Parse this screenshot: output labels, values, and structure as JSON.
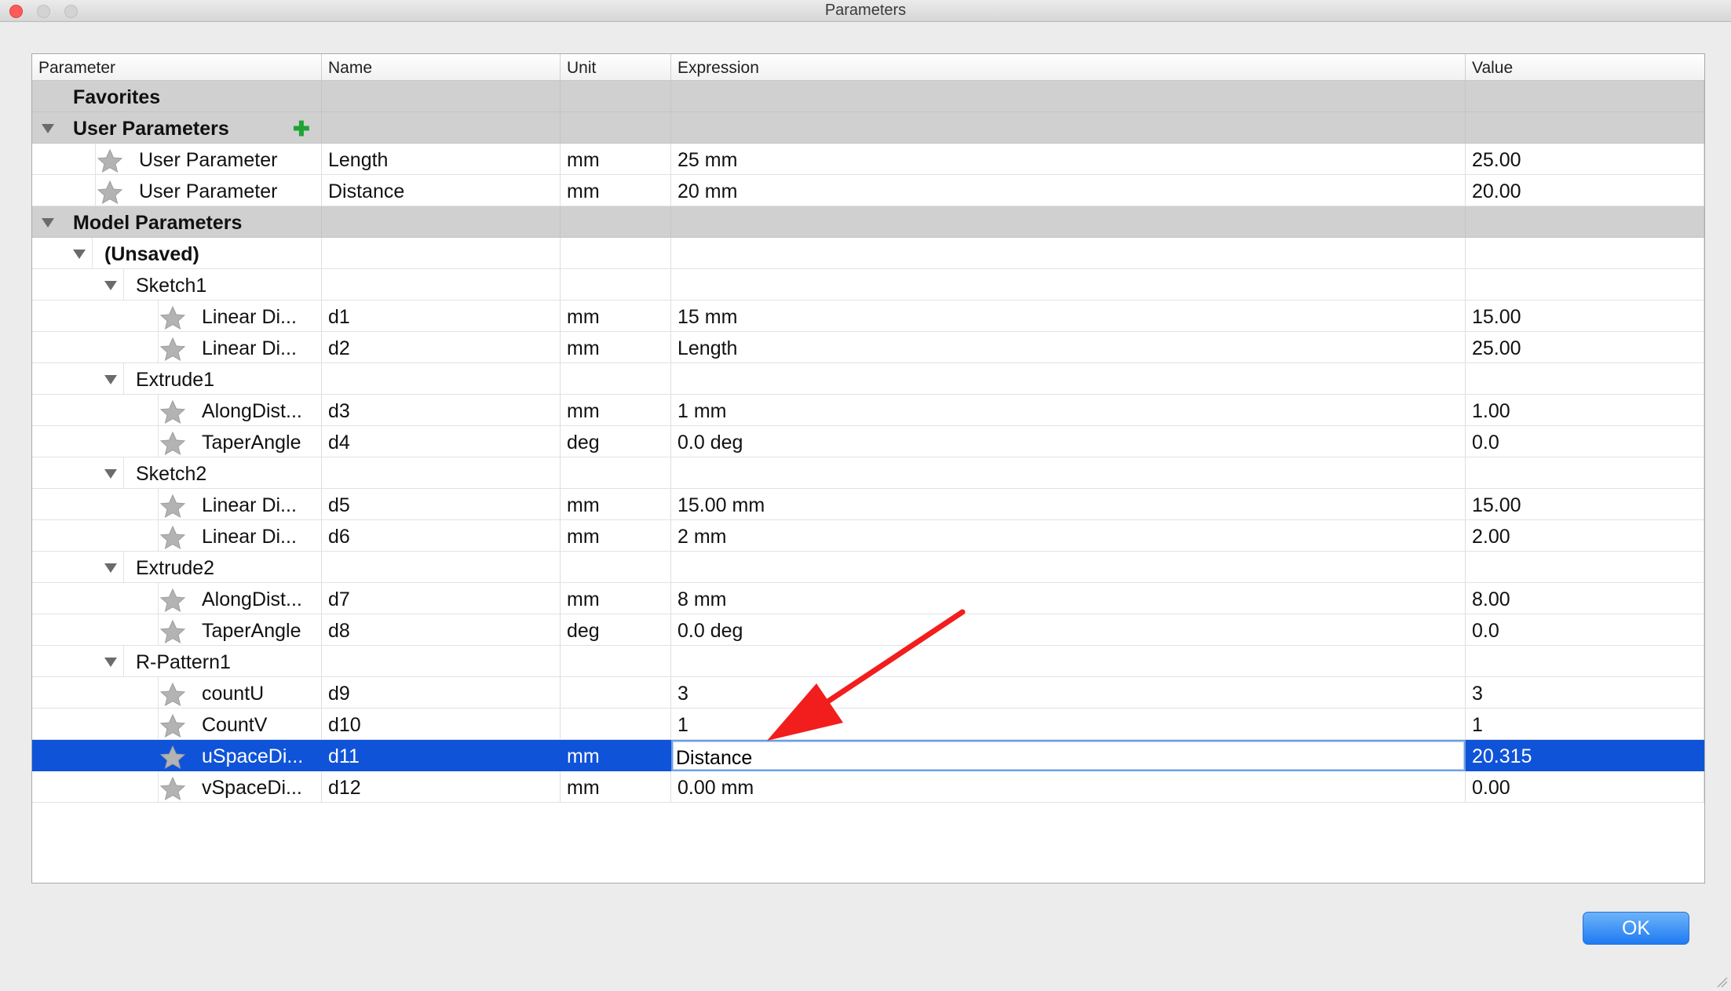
{
  "window": {
    "title": "Parameters"
  },
  "table": {
    "columns": [
      "Parameter",
      "Name",
      "Unit",
      "Expression",
      "Value"
    ],
    "rows": [
      {
        "kind": "group",
        "level": 0,
        "expander": false,
        "parameter": "Favorites",
        "name": "",
        "unit": "",
        "expression": "",
        "value": ""
      },
      {
        "kind": "group",
        "level": 0,
        "expander": true,
        "parameter": "User Parameters",
        "add": true,
        "name": "",
        "unit": "",
        "expression": "",
        "value": ""
      },
      {
        "kind": "param",
        "level": 1,
        "star": true,
        "parameter": "User Parameter",
        "name": "Length",
        "unit": "mm",
        "expression": "25 mm",
        "value": "25.00"
      },
      {
        "kind": "param",
        "level": 1,
        "star": true,
        "parameter": "User Parameter",
        "name": "Distance",
        "unit": "mm",
        "expression": "20 mm",
        "value": "20.00"
      },
      {
        "kind": "group",
        "level": 0,
        "expander": true,
        "parameter": "Model Parameters",
        "name": "",
        "unit": "",
        "expression": "",
        "value": ""
      },
      {
        "kind": "folder",
        "level": 1,
        "expander": true,
        "bold": true,
        "parameter": "(Unsaved)",
        "name": "",
        "unit": "",
        "expression": "",
        "value": ""
      },
      {
        "kind": "folder",
        "level": 2,
        "expander": true,
        "parameter": "Sketch1",
        "name": "",
        "unit": "",
        "expression": "",
        "value": ""
      },
      {
        "kind": "param",
        "level": 3,
        "star": true,
        "parameter": "Linear Di...",
        "name": "d1",
        "unit": "mm",
        "expression": "15 mm",
        "value": "15.00"
      },
      {
        "kind": "param",
        "level": 3,
        "star": true,
        "parameter": "Linear Di...",
        "name": "d2",
        "unit": "mm",
        "expression": "Length",
        "value": "25.00"
      },
      {
        "kind": "folder",
        "level": 2,
        "expander": true,
        "parameter": "Extrude1",
        "name": "",
        "unit": "",
        "expression": "",
        "value": ""
      },
      {
        "kind": "param",
        "level": 3,
        "star": true,
        "parameter": "AlongDist...",
        "name": "d3",
        "unit": "mm",
        "expression": "1 mm",
        "value": "1.00"
      },
      {
        "kind": "param",
        "level": 3,
        "star": true,
        "parameter": "TaperAngle",
        "name": "d4",
        "unit": "deg",
        "expression": "0.0 deg",
        "value": "0.0"
      },
      {
        "kind": "folder",
        "level": 2,
        "expander": true,
        "parameter": "Sketch2",
        "name": "",
        "unit": "",
        "expression": "",
        "value": ""
      },
      {
        "kind": "param",
        "level": 3,
        "star": true,
        "parameter": "Linear Di...",
        "name": "d5",
        "unit": "mm",
        "expression": "15.00 mm",
        "value": "15.00"
      },
      {
        "kind": "param",
        "level": 3,
        "star": true,
        "parameter": "Linear Di...",
        "name": "d6",
        "unit": "mm",
        "expression": "2 mm",
        "value": "2.00"
      },
      {
        "kind": "folder",
        "level": 2,
        "expander": true,
        "parameter": "Extrude2",
        "name": "",
        "unit": "",
        "expression": "",
        "value": ""
      },
      {
        "kind": "param",
        "level": 3,
        "star": true,
        "parameter": "AlongDist...",
        "name": "d7",
        "unit": "mm",
        "expression": "8 mm",
        "value": "8.00"
      },
      {
        "kind": "param",
        "level": 3,
        "star": true,
        "parameter": "TaperAngle",
        "name": "d8",
        "unit": "deg",
        "expression": "0.0 deg",
        "value": "0.0"
      },
      {
        "kind": "folder",
        "level": 2,
        "expander": true,
        "parameter": "R-Pattern1",
        "name": "",
        "unit": "",
        "expression": "",
        "value": ""
      },
      {
        "kind": "param",
        "level": 3,
        "star": true,
        "parameter": "countU",
        "name": "d9",
        "unit": "",
        "expression": "3",
        "value": "3"
      },
      {
        "kind": "param",
        "level": 3,
        "star": true,
        "parameter": "CountV",
        "name": "d10",
        "unit": "",
        "expression": "1",
        "value": "1"
      },
      {
        "kind": "param",
        "level": 3,
        "star": true,
        "selected": true,
        "editing": true,
        "parameter": "uSpaceDi...",
        "name": "d11",
        "unit": "mm",
        "expression": "Distance",
        "value": "20.315"
      },
      {
        "kind": "param",
        "level": 3,
        "star": true,
        "parameter": "vSpaceDi...",
        "name": "d12",
        "unit": "mm",
        "expression": "0.00 mm",
        "value": "0.00"
      }
    ]
  },
  "icons": {
    "favorite": "star-icon",
    "add": "plus-icon",
    "expand": "disclosure-triangle-icon"
  },
  "colors": {
    "selection": "#0f53d8",
    "group_bg": "#d0d0d0",
    "annotation_arrow": "#f21d1d",
    "add_icon": "#1fa335",
    "ok_button": "#1f7bf2"
  },
  "footer": {
    "ok_label": "OK"
  }
}
